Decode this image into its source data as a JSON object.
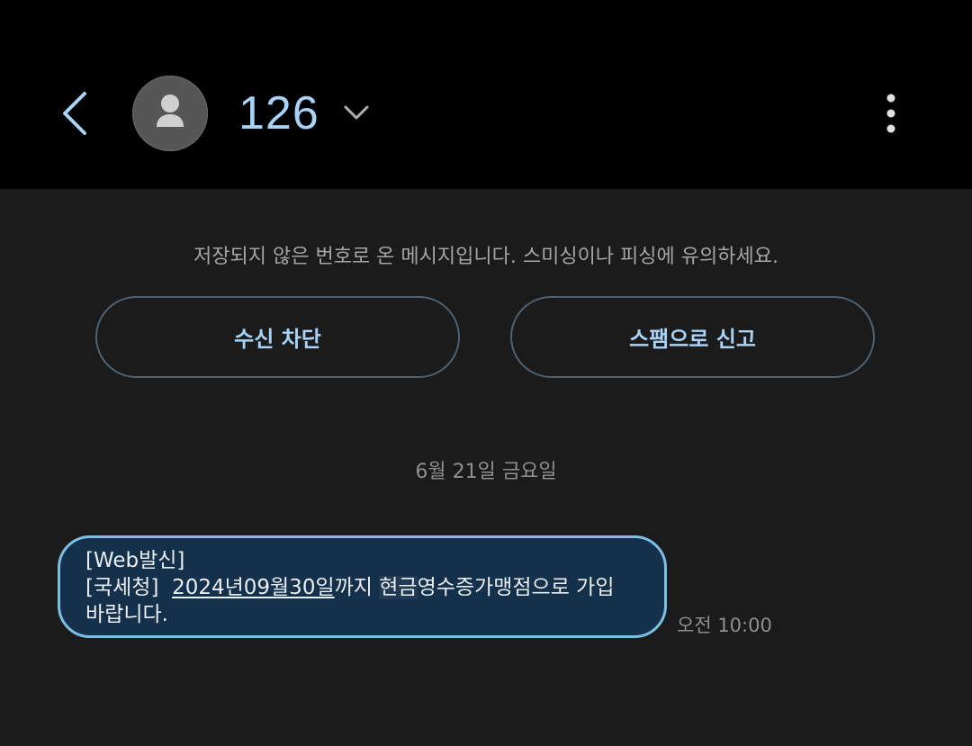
{
  "header": {
    "contact": "126",
    "back_icon": "chevron-left-icon",
    "avatar_icon": "person-icon",
    "expand_icon": "chevron-down-icon",
    "more_icon": "more-vertical-icon"
  },
  "notice": {
    "text": "저장되지 않은 번호로 온 메시지입니다. 스미싱이나 피싱에 유의하세요."
  },
  "actions": {
    "block_label": "수신 차단",
    "spam_label": "스팸으로 신고"
  },
  "conversation": {
    "date": "6월 21일 금요일",
    "messages": [
      {
        "line1": "[Web발신]",
        "line2_prefix": "[국세청]  ",
        "date_link": "2024년09월30일",
        "mid": "까지 ",
        "highlight": "현금",
        "line2_suffix": "영수증가맹점으로 가입",
        "line3": "바랍니다.",
        "time": "오전 10:00"
      }
    ]
  },
  "colors": {
    "accent": "#a9d3f6",
    "bubble_bg": "#14304a",
    "bubble_border": "#7cbfe6",
    "background": "#1b1b1b",
    "header_bg": "#000000"
  }
}
